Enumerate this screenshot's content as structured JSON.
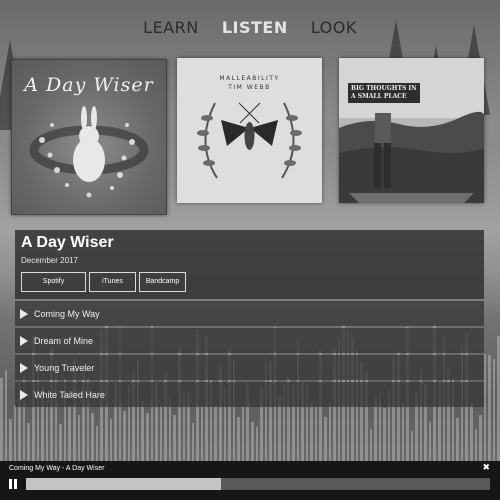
{
  "nav": {
    "items": [
      "LEARN",
      "LISTEN",
      "LOOK"
    ],
    "active": "LISTEN"
  },
  "albums": [
    {
      "cover_text": "A Day Wiser"
    },
    {
      "cover_text": "MALLEABILITY",
      "cover_subtext": "TIM WEBB"
    },
    {
      "cover_text": "BIG THOUGHTS IN A SMALL PLACE"
    }
  ],
  "album": {
    "title": "A Day Wiser",
    "date": "December 2017",
    "links": [
      "Spotify",
      "iTunes",
      "Bandcamp"
    ],
    "tracks": [
      "Coming My Way",
      "Dream of Mine",
      "Young Traveler",
      "White Tailed Hare"
    ]
  },
  "player": {
    "now_playing": "Coming My Way - A Day Wiser",
    "close_label": "✖",
    "progress": 0.42
  },
  "colors": {
    "background": "#7a7a7a",
    "panel": "#2d2d2d",
    "player": "#161616",
    "progress_fill": "#c4c4c4"
  },
  "icons": [
    "play-icon",
    "pause-icon",
    "close-icon"
  ]
}
